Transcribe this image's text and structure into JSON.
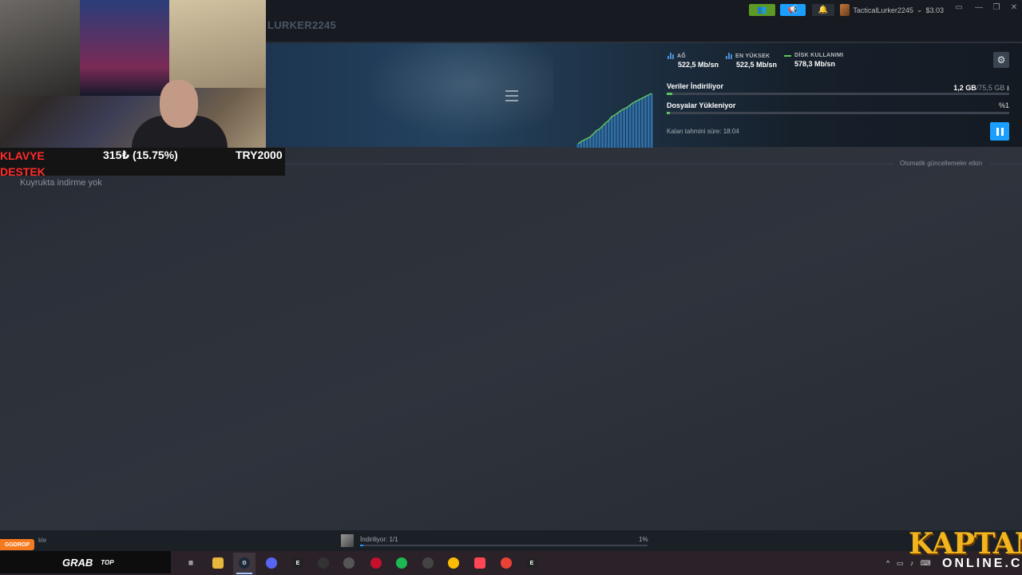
{
  "header": {
    "username_heading": "LURKER2245",
    "account_name": "TacticalLurker2245",
    "wallet": "$3.03",
    "window_controls": [
      "▭",
      "—",
      "❐",
      "✕"
    ]
  },
  "download": {
    "stats": [
      {
        "label": "AĞ",
        "value": "522,5 Mb/sn",
        "icon": "bar-chart-icon"
      },
      {
        "label": "EN YÜKSEK",
        "value": "522,5 Mb/sn",
        "icon": "bar-chart-icon"
      },
      {
        "label": "DİSK KULLANIMI",
        "value": "578,3 Mb/sn",
        "icon": "line-icon"
      }
    ],
    "downloading_label": "Veriler İndiriliyor",
    "downloading_amount": "1,2 GB",
    "downloading_total": "/75,5 GB",
    "downloading_progress": 0.016,
    "installing_label": "Dosyalar Yükleniyor",
    "installing_pct": "%1",
    "installing_progress": 0.01,
    "eta": "Kalan tahmini süre: 18:04",
    "graph_values": [
      5,
      8,
      10,
      12,
      14,
      18,
      22,
      24,
      28,
      32,
      35,
      40,
      42,
      45,
      48,
      50,
      52,
      55,
      58,
      60,
      62,
      64,
      66,
      68,
      70
    ],
    "colors": {
      "accent": "#1a9fff",
      "graph_line": "#5ec45e",
      "graph_bar": "#2f6fa8"
    }
  },
  "queue": {
    "auto_updates": "Otomatik güncellemeler etkin",
    "empty_text": "Kuyrukta indirme yok"
  },
  "overlay": {
    "klavye_line1": "KLAVYE",
    "klavye_line2": "DESTEK",
    "price": "315₺ (15.75%)",
    "try_goal": "TRY2000"
  },
  "bottom": {
    "add_game": "kle",
    "status": "İndiriliyor: 1/1",
    "percent": "1%",
    "progress": 0.01
  },
  "taskbar": {
    "ggdrop": "GGDROP",
    "grab": "GRAB",
    "top": "TOP",
    "watermark_top": "KAPTAN",
    "watermark_bottom": "ONLINE.COM"
  }
}
